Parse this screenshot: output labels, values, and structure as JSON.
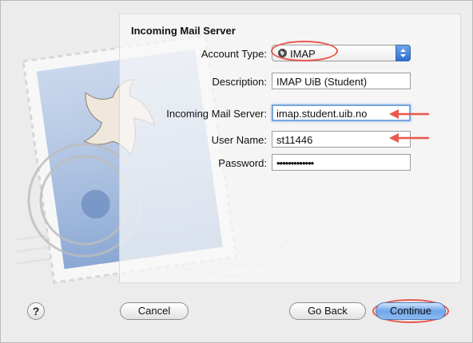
{
  "panel": {
    "title": "Incoming Mail Server"
  },
  "form": {
    "account_type_label": "Account Type:",
    "account_type_value": "IMAP",
    "description_label": "Description:",
    "description_value": "IMAP UiB (Student)",
    "server_label": "Incoming Mail Server:",
    "server_value": "imap.student.uib.no",
    "username_label": "User Name:",
    "username_value": "st11446",
    "password_label": "Password:",
    "password_value": "•••••••••••••"
  },
  "buttons": {
    "help": "?",
    "cancel": "Cancel",
    "go_back": "Go Back",
    "continue": "Continue"
  },
  "colors": {
    "annotation": "#e8594c",
    "focus": "#7aa6dd",
    "primary_button": "#6ea6ea"
  },
  "icons": [
    "globe-icon",
    "popup-stepper-icon",
    "help-icon",
    "annotation-arrow-icon"
  ]
}
